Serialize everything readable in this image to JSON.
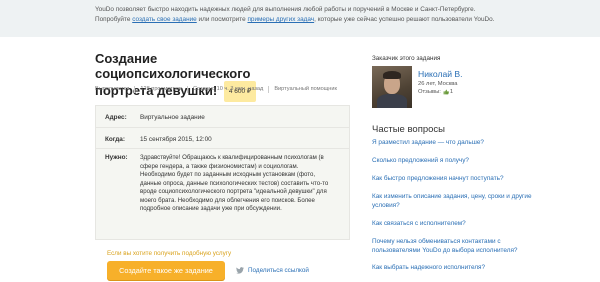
{
  "topbar": {
    "line1_text": "YouDo позволяет быстро находить надежных людей для выполнения любой работы и поручений в Москве и Санкт-Петербурге.",
    "line2_prefix": "Попробуйте",
    "create_task_link": "создать свое задание",
    "line2_middle": "или посмотрите",
    "examples_link": "примеры других задач",
    "line2_suffix": ", которые уже сейчас успешно решают пользователи YouDo."
  },
  "task": {
    "title": "Создание социопсихологического портрета девушки!",
    "price": "4 600 ₽",
    "meta": [
      "Выполняется",
      "128 просмотров",
      "Создано 10 ч. 3 мин. назад",
      "Виртуальный помощник"
    ],
    "address_label": "Адрес:",
    "address_value": "Виртуальное задание",
    "when_label": "Когда:",
    "when_value": "15 сентября 2015, 12:00",
    "needs_label": "Нужно:",
    "needs_text": "Здравствуйте! Обращаюсь к квалифицированным психологам (в сфере гендера, а также физиономистам) и социологам. Необходимо будет по заданным исходным установкам (фото, данные опроса, данные психологических тестов) составить что-то вроде социопсихологического портрета \"идеальной девушки\" для моего брата. Необходимо для облегчения его поисков. Более подробное описание задачи уже при обсуждении."
  },
  "actions": {
    "similar_link": "Если вы хотите получить подобную услугу",
    "create_button": "Создайте такое же задание",
    "share_link": "Поделиться ссылкой"
  },
  "customer": {
    "heading": "Заказчик этого задания",
    "name": "Николай В.",
    "location": "26 лет, Москва",
    "reviews_label": "Отзывы:",
    "reviews_count": "1"
  },
  "faq": {
    "heading": "Частые вопросы",
    "items": [
      "Я разместил задание — что дальше?",
      "Сколько предложений я получу?",
      "Как быстро предложения начнут поступать?",
      "Как изменить описание задания, цену, сроки и другие условия?",
      "Как связаться с исполнителем?",
      "Почему нельзя обмениваться контактами с пользователями YouDo до выбора исполнителя?",
      "Как выбрать надежного исполнителя?"
    ]
  },
  "colors": {
    "link": "#2a6fb5",
    "button": "#f7b02a",
    "price_badge": "#fdeaa0",
    "topbar_bg": "#eef2f3"
  }
}
